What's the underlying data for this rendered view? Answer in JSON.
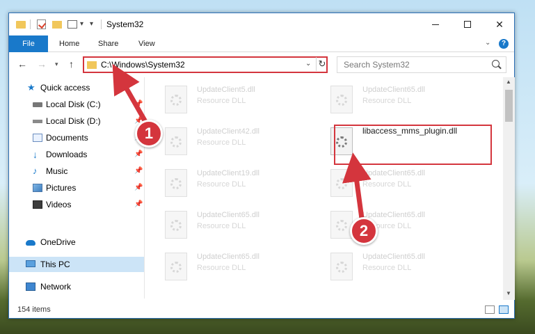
{
  "window": {
    "title": "System32"
  },
  "ribbon": {
    "tabs": [
      "File",
      "Home",
      "Share",
      "View"
    ],
    "help": "?"
  },
  "address": {
    "path": "C:\\Windows\\System32",
    "search_placeholder": "Search System32"
  },
  "sidebar": {
    "items": [
      {
        "label": "Quick access",
        "icon": "star-icon"
      },
      {
        "label": "Local Disk (C:)",
        "icon": "disk-icon"
      },
      {
        "label": "Local Disk (D:)",
        "icon": "disk-icon"
      },
      {
        "label": "Documents",
        "icon": "documents-icon"
      },
      {
        "label": "Downloads",
        "icon": "download-icon"
      },
      {
        "label": "Music",
        "icon": "music-icon"
      },
      {
        "label": "Pictures",
        "icon": "pictures-icon"
      },
      {
        "label": "Videos",
        "icon": "videos-icon"
      },
      {
        "label": "OneDrive",
        "icon": "cloud-icon"
      },
      {
        "label": "This PC",
        "icon": "computer-icon"
      },
      {
        "label": "Network",
        "icon": "network-icon"
      }
    ]
  },
  "files": [
    {
      "name": "UpdateClient5.dll",
      "type": "Resource DLL"
    },
    {
      "name": "UpdateClient65.dll",
      "type": "Resource DLL"
    },
    {
      "name": "UpdateClient42.dll",
      "type": "Resource DLL"
    },
    {
      "name": "libaccess_mms_plugin.dll",
      "type": ""
    },
    {
      "name": "UpdateClient19.dll",
      "type": "Resource DLL"
    },
    {
      "name": "UpdateClient65.dll",
      "type": "Resource DLL"
    },
    {
      "name": "UpdateClient65.dll",
      "type": "Resource DLL"
    },
    {
      "name": "UpdateClient65.dll",
      "type": "Resource DLL"
    },
    {
      "name": "UpdateClient65.dll",
      "type": "Resource DLL"
    },
    {
      "name": "UpdateClient65.dll",
      "type": "Resource DLL"
    }
  ],
  "status": {
    "item_count": "154 items"
  },
  "annotations": {
    "step1": "1",
    "step2": "2"
  },
  "colors": {
    "accent": "#1979ca",
    "highlight": "#d4353d",
    "selected": "#cce4f7"
  }
}
